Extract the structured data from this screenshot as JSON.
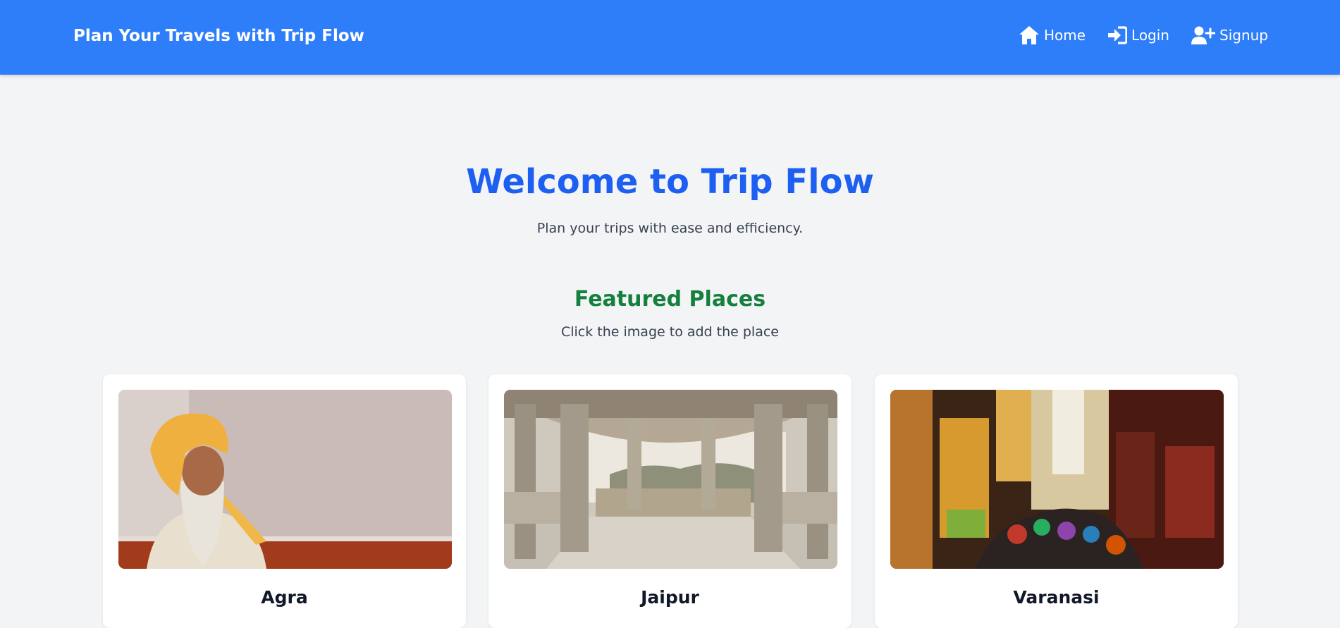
{
  "navbar": {
    "brand": "Plan Your Travels with Trip Flow",
    "links": [
      {
        "label": "Home",
        "icon": "home-icon"
      },
      {
        "label": "Login",
        "icon": "login-icon"
      },
      {
        "label": "Signup",
        "icon": "user-plus-icon"
      }
    ],
    "background_color": "#2f7ef9"
  },
  "hero": {
    "title": "Welcome to Trip Flow",
    "subtitle": "Plan your trips with ease and efficiency."
  },
  "featured": {
    "title": "Featured Places",
    "subtitle": "Click the image to add the place",
    "places": [
      {
        "name": "Agra",
        "image": "sadhu-portrait-photo"
      },
      {
        "name": "Jaipur",
        "image": "marble-pavilion-photo"
      },
      {
        "name": "Varanasi",
        "image": "market-street-photo"
      }
    ]
  },
  "colors": {
    "accent_blue": "#1d5ff0",
    "accent_green": "#15803d",
    "page_background": "#f3f4f6"
  }
}
